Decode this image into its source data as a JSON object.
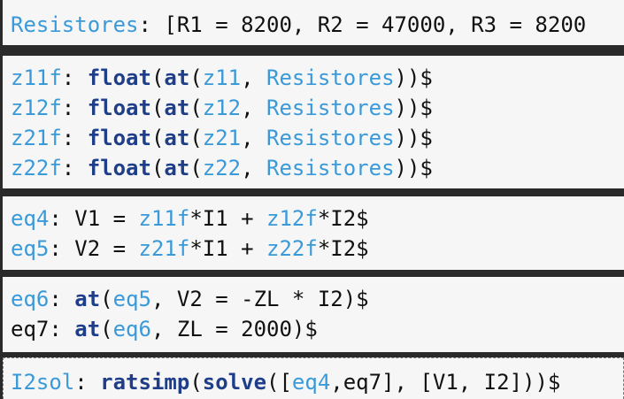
{
  "cells": [
    {
      "id": "cell-1",
      "lines": [
        [
          {
            "t": "Resistores",
            "s": "ident"
          },
          {
            "t": ": [R1 = 8200, R2 = 47000, R3 = 8200",
            "s": "plain"
          }
        ]
      ]
    },
    {
      "id": "cell-2",
      "lines": [
        [
          {
            "t": "z11f",
            "s": "ident"
          },
          {
            "t": ": ",
            "s": "plain"
          },
          {
            "t": "float",
            "s": "fn"
          },
          {
            "t": "(",
            "s": "plain"
          },
          {
            "t": "at",
            "s": "fn"
          },
          {
            "t": "(",
            "s": "plain"
          },
          {
            "t": "z11",
            "s": "ident"
          },
          {
            "t": ", ",
            "s": "plain"
          },
          {
            "t": "Resistores",
            "s": "ident"
          },
          {
            "t": "))$",
            "s": "plain"
          }
        ],
        [
          {
            "t": "z12f",
            "s": "ident"
          },
          {
            "t": ": ",
            "s": "plain"
          },
          {
            "t": "float",
            "s": "fn"
          },
          {
            "t": "(",
            "s": "plain"
          },
          {
            "t": "at",
            "s": "fn"
          },
          {
            "t": "(",
            "s": "plain"
          },
          {
            "t": "z12",
            "s": "ident"
          },
          {
            "t": ", ",
            "s": "plain"
          },
          {
            "t": "Resistores",
            "s": "ident"
          },
          {
            "t": "))$",
            "s": "plain"
          }
        ],
        [
          {
            "t": "z21f",
            "s": "ident"
          },
          {
            "t": ": ",
            "s": "plain"
          },
          {
            "t": "float",
            "s": "fn"
          },
          {
            "t": "(",
            "s": "plain"
          },
          {
            "t": "at",
            "s": "fn"
          },
          {
            "t": "(",
            "s": "plain"
          },
          {
            "t": "z21",
            "s": "ident"
          },
          {
            "t": ", ",
            "s": "plain"
          },
          {
            "t": "Resistores",
            "s": "ident"
          },
          {
            "t": "))$",
            "s": "plain"
          }
        ],
        [
          {
            "t": "z22f",
            "s": "ident"
          },
          {
            "t": ": ",
            "s": "plain"
          },
          {
            "t": "float",
            "s": "fn"
          },
          {
            "t": "(",
            "s": "plain"
          },
          {
            "t": "at",
            "s": "fn"
          },
          {
            "t": "(",
            "s": "plain"
          },
          {
            "t": "z22",
            "s": "ident"
          },
          {
            "t": ", ",
            "s": "plain"
          },
          {
            "t": "Resistores",
            "s": "ident"
          },
          {
            "t": "))$",
            "s": "plain"
          }
        ]
      ]
    },
    {
      "id": "cell-3",
      "lines": [
        [
          {
            "t": "eq4",
            "s": "ident"
          },
          {
            "t": ": V1 = ",
            "s": "plain"
          },
          {
            "t": "z11f",
            "s": "ident"
          },
          {
            "t": "*I1 + ",
            "s": "plain"
          },
          {
            "t": "z12f",
            "s": "ident"
          },
          {
            "t": "*I2$",
            "s": "plain"
          }
        ],
        [
          {
            "t": "eq5",
            "s": "ident"
          },
          {
            "t": ": V2 = ",
            "s": "plain"
          },
          {
            "t": "z21f",
            "s": "ident"
          },
          {
            "t": "*I1 + ",
            "s": "plain"
          },
          {
            "t": "z22f",
            "s": "ident"
          },
          {
            "t": "*I2$",
            "s": "plain"
          }
        ]
      ]
    },
    {
      "id": "cell-4",
      "lines": [
        [
          {
            "t": "eq6",
            "s": "ident"
          },
          {
            "t": ": ",
            "s": "plain"
          },
          {
            "t": "at",
            "s": "fn"
          },
          {
            "t": "(",
            "s": "plain"
          },
          {
            "t": "eq5",
            "s": "ident"
          },
          {
            "t": ", V2 = -ZL * I2)$",
            "s": "plain"
          }
        ],
        [
          {
            "t": "eq7: ",
            "s": "plain"
          },
          {
            "t": "at",
            "s": "fn"
          },
          {
            "t": "(",
            "s": "plain"
          },
          {
            "t": "eq6",
            "s": "ident"
          },
          {
            "t": ", ZL = 2000)$",
            "s": "plain"
          }
        ]
      ]
    },
    {
      "id": "cell-5",
      "lines": [
        [
          {
            "t": "I2sol",
            "s": "ident"
          },
          {
            "t": ": ",
            "s": "plain"
          },
          {
            "t": "ratsimp",
            "s": "fn"
          },
          {
            "t": "(",
            "s": "plain"
          },
          {
            "t": "solve",
            "s": "fn"
          },
          {
            "t": "([",
            "s": "plain"
          },
          {
            "t": "eq4",
            "s": "ident"
          },
          {
            "t": ",eq7], [V1, I2]))$",
            "s": "plain"
          }
        ]
      ]
    }
  ]
}
